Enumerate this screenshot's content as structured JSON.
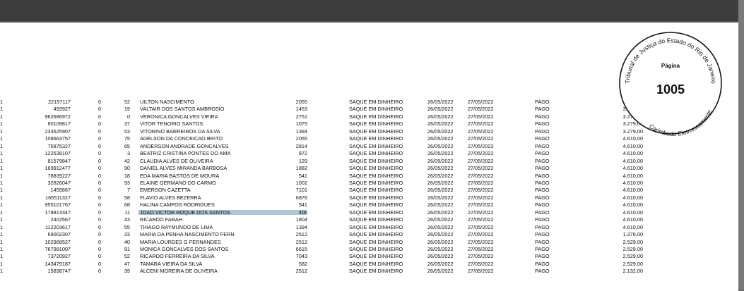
{
  "stamp": {
    "top_text": "Tribunal de Justiça do Estado do Rio de Janeiro",
    "bottom_text": "Carimbado Eletronicamente",
    "page_label": "Página",
    "page_number": "1005"
  },
  "rows": [
    {
      "edge": "1",
      "id": "22157117",
      "zero": "0",
      "n2": "52",
      "name": "UILTON NASCIMENTO",
      "code": "2055",
      "type": "SAQUE EM DINHEIRO",
      "d1": "26/05/2022",
      "d2": "27/05/2022",
      "status": "PAGO",
      "value": "3.279,00"
    },
    {
      "edge": "1",
      "id": "493927",
      "zero": "0",
      "n2": "19",
      "name": "VALTAIR DOS SANTOS AMBROSIO",
      "code": "1453",
      "type": "SAQUE EM DINHEIRO",
      "d1": "26/05/2022",
      "d2": "27/05/2022",
      "status": "PAGO",
      "value": "3.279,00"
    },
    {
      "edge": "1",
      "id": "962686972",
      "zero": "0",
      "n2": "0",
      "name": "VERONICA GONCALVES VIEIRA",
      "code": "2751",
      "type": "SAQUE EM DINHEIRO",
      "d1": "26/05/2022",
      "d2": "27/05/2022",
      "status": "PAGO",
      "value": "3.279,00"
    },
    {
      "edge": "1",
      "id": "80109817",
      "zero": "0",
      "n2": "37",
      "name": "VITOR TENORIO SANTOS",
      "code": "1075",
      "type": "SAQUE EM DINHEIRO",
      "d1": "26/05/2022",
      "d2": "27/05/2022",
      "status": "PAGO",
      "value": "3.279,00"
    },
    {
      "edge": "1",
      "id": "233525907",
      "zero": "0",
      "n2": "53",
      "name": "VITORINO BARREIROS DA SILVA",
      "code": "1394",
      "type": "SAQUE EM DINHEIRO",
      "d1": "26/05/2022",
      "d2": "27/05/2022",
      "status": "PAGO",
      "value": "3.279,00"
    },
    {
      "edge": "1",
      "id": "108663757",
      "zero": "0",
      "n2": "75",
      "name": "ADELSON DA CONCEICAO BRITO",
      "code": "2055",
      "type": "SAQUE EM DINHEIRO",
      "d1": "26/05/2022",
      "d2": "27/05/2022",
      "status": "PAGO",
      "value": "4.610,00"
    },
    {
      "edge": "1",
      "id": "75875327",
      "zero": "0",
      "n2": "65",
      "name": "ANDERSON ANDRADE GONCALVES",
      "code": "2814",
      "type": "SAQUE EM DINHEIRO",
      "d1": "26/05/2022",
      "d2": "27/05/2022",
      "status": "PAGO",
      "value": "4.610,00"
    },
    {
      "edge": "1",
      "id": "122538107",
      "zero": "0",
      "n2": "3",
      "name": "BEATRIZ CRISTINA PONTES DO AMA",
      "code": "872",
      "type": "SAQUE EM DINHEIRO",
      "d1": "26/05/2022",
      "d2": "27/05/2022",
      "status": "PAGO",
      "value": "4.610,00"
    },
    {
      "edge": "1",
      "id": "81579847",
      "zero": "0",
      "n2": "42",
      "name": "CLAUDIA ALVES DE OLIVEIRA",
      "code": "129",
      "type": "SAQUE EM DINHEIRO",
      "d1": "26/05/2022",
      "d2": "27/05/2022",
      "status": "PAGO",
      "value": "4.610,00"
    },
    {
      "edge": "1",
      "id": "169912477",
      "zero": "0",
      "n2": "90",
      "name": "DANIEL ALVES MIRANDA BARBOSA",
      "code": "1882",
      "type": "SAQUE EM DINHEIRO",
      "d1": "26/05/2022",
      "d2": "27/05/2022",
      "status": "PAGO",
      "value": "4.610,00"
    },
    {
      "edge": "1",
      "id": "78839227",
      "zero": "0",
      "n2": "18",
      "name": "EDA MARIA BASTOS DE MOURA",
      "code": "541",
      "type": "SAQUE EM DINHEIRO",
      "d1": "26/05/2022",
      "d2": "27/05/2022",
      "status": "PAGO",
      "value": "4.610,00"
    },
    {
      "edge": "1",
      "id": "32826047",
      "zero": "0",
      "n2": "93",
      "name": "ELAINE GERMANO DO CARMO",
      "code": "1002",
      "type": "SAQUE EM DINHEIRO",
      "d1": "26/05/2022",
      "d2": "27/05/2022",
      "status": "PAGO",
      "value": "4.610,00"
    },
    {
      "edge": "1",
      "id": "1455867",
      "zero": "0",
      "n2": "7",
      "name": "EMERSON CAZETTA",
      "code": "7101",
      "type": "SAQUE EM DINHEIRO",
      "d1": "26/05/2022",
      "d2": "27/05/2022",
      "status": "PAGO",
      "value": "4.610,00"
    },
    {
      "edge": "1",
      "id": "165511327",
      "zero": "0",
      "n2": "58",
      "name": "FLAVIO ALVES BEZERRA",
      "code": "6876",
      "type": "SAQUE EM DINHEIRO",
      "d1": "26/05/2022",
      "d2": "27/05/2022",
      "status": "PAGO",
      "value": "4.610,00"
    },
    {
      "edge": "1",
      "id": "955101767",
      "zero": "0",
      "n2": "68",
      "name": "HALINA CAMPOS RODRIGUES",
      "code": "541",
      "type": "SAQUE EM DINHEIRO",
      "d1": "26/05/2022",
      "d2": "27/05/2022",
      "status": "PAGO",
      "value": "4.610,00"
    },
    {
      "edge": "1",
      "id": "178813347",
      "zero": "0",
      "n2": "11",
      "name": "JOAO VICTOR ROQUE DOS SANTOS",
      "code": "406",
      "type": "SAQUE EM DINHEIRO",
      "d1": "26/05/2022",
      "d2": "27/05/2022",
      "status": "PAGO",
      "value": "4.610,00"
    },
    {
      "edge": "1",
      "id": "2402567",
      "zero": "0",
      "n2": "43",
      "name": "RICARDO FARAH",
      "code": "1804",
      "type": "SAQUE EM DINHEIRO",
      "d1": "26/05/2022",
      "d2": "27/05/2022",
      "status": "PAGO",
      "value": "4.610,00"
    },
    {
      "edge": "1",
      "id": "112203617",
      "zero": "0",
      "n2": "55",
      "name": "THIAGO RAYMUNDO DE LIMA",
      "code": "1394",
      "type": "SAQUE EM DINHEIRO",
      "d1": "26/05/2022",
      "d2": "27/05/2022",
      "status": "PAGO",
      "value": "4.610,00"
    },
    {
      "edge": "1",
      "id": "69002307",
      "zero": "0",
      "n2": "33",
      "name": "MARIA DA PENHA NASCIMENTO FERN",
      "code": "2512",
      "type": "SAQUE EM DINHEIRO",
      "d1": "26/05/2022",
      "d2": "27/05/2022",
      "status": "PAGO",
      "value": "1.376,00"
    },
    {
      "edge": "1",
      "id": "102968527",
      "zero": "0",
      "n2": "40",
      "name": "MARIA LOURDES G FERNANDES",
      "code": "2512",
      "type": "SAQUE EM DINHEIRO",
      "d1": "26/05/2022",
      "d2": "27/05/2022",
      "status": "PAGO",
      "value": "2.529,00"
    },
    {
      "edge": "1",
      "id": "767981007",
      "zero": "0",
      "n2": "91",
      "name": "MONICA GONCALVES DOS SANTOS",
      "code": "6615",
      "type": "SAQUE EM DINHEIRO",
      "d1": "26/05/2022",
      "d2": "27/05/2022",
      "status": "PAGO",
      "value": "2.529,00"
    },
    {
      "edge": "1",
      "id": "73720927",
      "zero": "0",
      "n2": "52",
      "name": "RICARDO FERREIRA DA SILVA",
      "code": "7043",
      "type": "SAQUE EM DINHEIRO",
      "d1": "26/05/2022",
      "d2": "27/05/2022",
      "status": "PAGO",
      "value": "2.529,00"
    },
    {
      "edge": "1",
      "id": "143479187",
      "zero": "0",
      "n2": "47",
      "name": "TAMARA VIEIRA DA SILVA",
      "code": "582",
      "type": "SAQUE EM DINHEIRO",
      "d1": "26/05/2022",
      "d2": "27/05/2022",
      "status": "PAGO",
      "value": "2.529,00"
    },
    {
      "edge": "1",
      "id": "15838747",
      "zero": "0",
      "n2": "39",
      "name": "ALCENI MOREIRA DE OLIVEIRA",
      "code": "2512",
      "type": "SAQUE EM DINHEIRO",
      "d1": "26/05/2022",
      "d2": "27/05/2022",
      "status": "PAGO",
      "value": "2.132,00"
    }
  ]
}
